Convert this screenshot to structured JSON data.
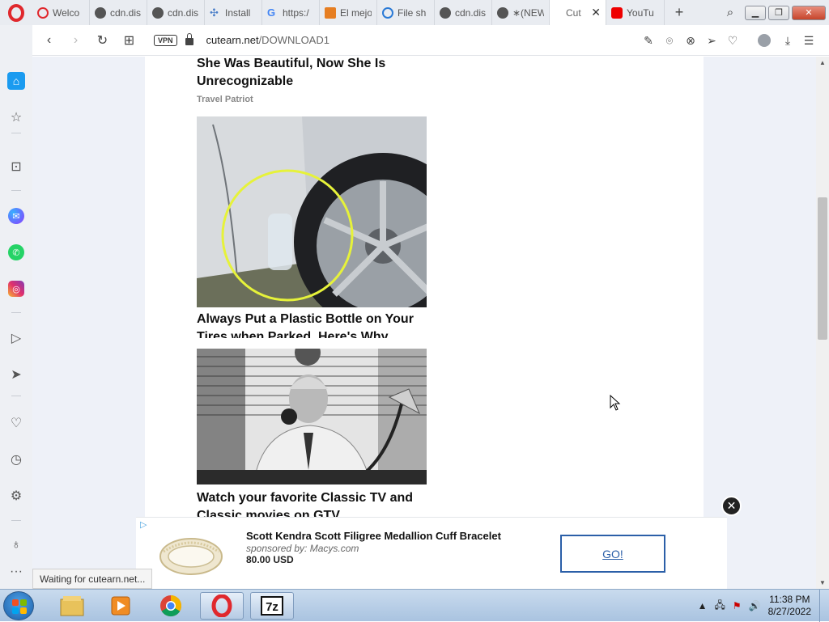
{
  "browser": {
    "tabs": [
      {
        "label": "Welco",
        "icon": "opera-icon"
      },
      {
        "label": "cdn.dis",
        "icon": "globe-icon"
      },
      {
        "label": "cdn.dis",
        "icon": "globe-icon"
      },
      {
        "label": "Install",
        "icon": "sparkle-icon"
      },
      {
        "label": "https:/",
        "icon": "google-icon"
      },
      {
        "label": "El mejo",
        "icon": "pencil-icon"
      },
      {
        "label": "File sh",
        "icon": "share-icon"
      },
      {
        "label": "cdn.dis",
        "icon": "globe-icon"
      },
      {
        "label": "∗(NEW",
        "icon": "globe-icon"
      },
      {
        "label": "Cut",
        "icon": "blank",
        "active": true
      },
      {
        "label": "YouTu",
        "icon": "youtube-icon"
      }
    ],
    "new_tab": "+",
    "url_domain": "cutearn.net",
    "url_path": "/DOWNLOAD1",
    "vpn_label": "VPN",
    "status_text": "Waiting for cutearn.net..."
  },
  "articles": [
    {
      "title": "She Was Beautiful, Now She Is Unrecognizable",
      "source": "Travel Patriot"
    },
    {
      "title": "Always Put a Plastic Bottle on Your Tires when Parked, Here's Why",
      "source": ""
    },
    {
      "title": "Watch your favorite Classic TV and Classic movies on GTV",
      "source": ""
    }
  ],
  "ad": {
    "title": "Scott Kendra Scott Filigree Medallion Cuff Bracelet",
    "sponsor": "sponsored by: Macys.com",
    "price": "80.00 USD",
    "button": "GO!",
    "close": "✕",
    "choice": "▷"
  },
  "taskbar": {
    "time": "11:38 PM",
    "date": "8/27/2022"
  },
  "colors": {
    "accent": "#1a9bf0",
    "opera_red": "#e0282d",
    "ad_button": "#2b5fa8"
  }
}
